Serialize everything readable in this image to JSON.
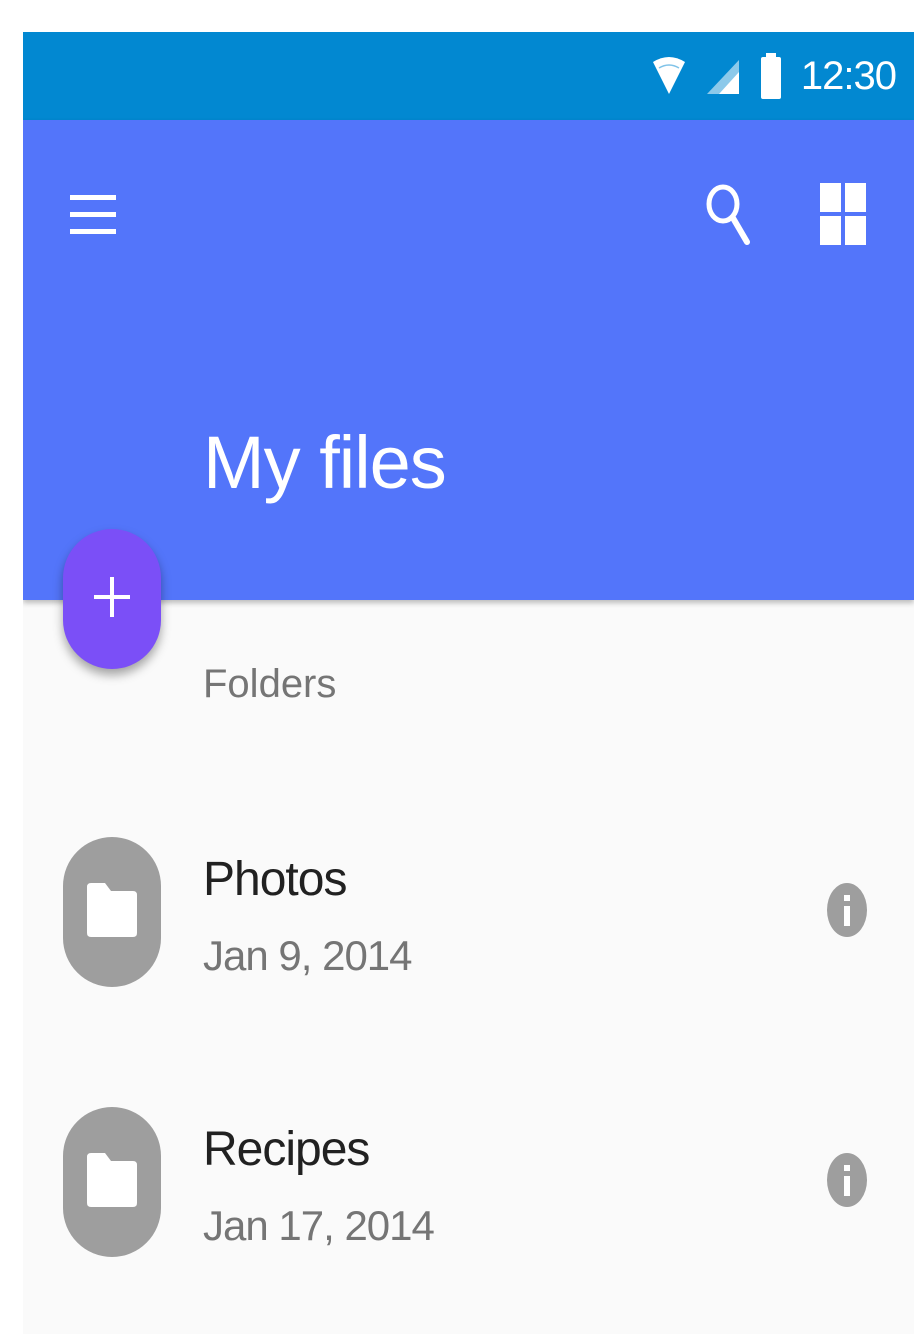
{
  "status_bar": {
    "time": "12:30",
    "icons": [
      "wifi-icon",
      "cellular-signal-icon",
      "battery-icon"
    ],
    "color": "#0288d1"
  },
  "app_bar": {
    "title": "My files",
    "color": "#5375fa",
    "icons": [
      "menu-icon",
      "search-icon",
      "grid-view-icon"
    ]
  },
  "fab": {
    "icon": "plus-icon",
    "color": "#7b4ff7"
  },
  "sections": [
    {
      "header": "Folders",
      "items": [
        {
          "name": "Photos",
          "date": "Jan 9, 2014",
          "icon": "folder-icon",
          "action_icon": "info-icon"
        },
        {
          "name": "Recipes",
          "date": "Jan 17, 2014",
          "icon": "folder-icon",
          "action_icon": "info-icon"
        }
      ]
    }
  ],
  "colors": {
    "background": "#fafafa",
    "avatar": "#9e9e9e",
    "primary_text": "#212121",
    "secondary_text": "#757575"
  }
}
